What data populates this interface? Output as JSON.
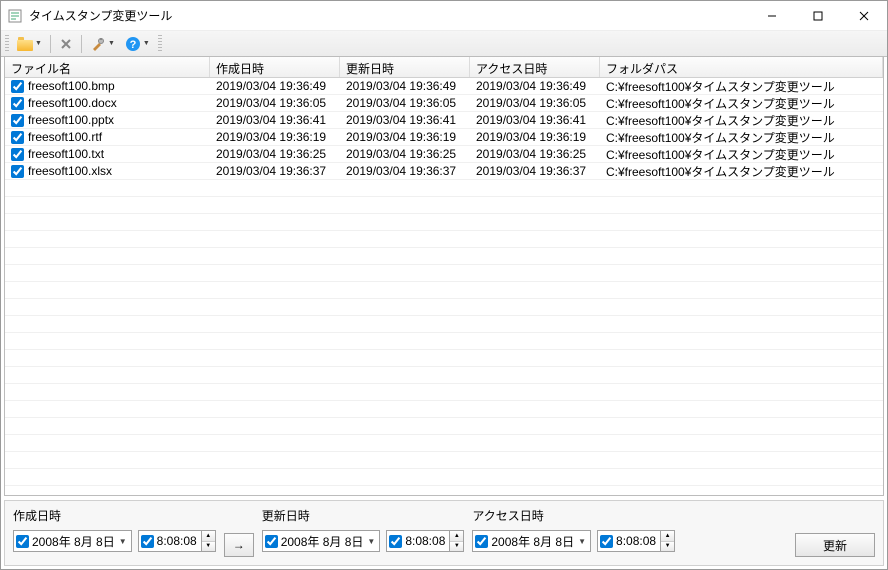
{
  "window": {
    "title": "タイムスタンプ変更ツール"
  },
  "toolbar": {
    "open_icon": "folder-open",
    "delete_icon": "x-delete",
    "settings_icon": "tools",
    "help_icon": "help"
  },
  "columns": {
    "name": "ファイル名",
    "created": "作成日時",
    "modified": "更新日時",
    "accessed": "アクセス日時",
    "path": "フォルダパス"
  },
  "files": [
    {
      "checked": true,
      "name": "freesoft100.bmp",
      "created": "2019/03/04 19:36:49",
      "modified": "2019/03/04 19:36:49",
      "accessed": "2019/03/04 19:36:49",
      "path": "C:¥freesoft100¥タイムスタンプ変更ツール"
    },
    {
      "checked": true,
      "name": "freesoft100.docx",
      "created": "2019/03/04 19:36:05",
      "modified": "2019/03/04 19:36:05",
      "accessed": "2019/03/04 19:36:05",
      "path": "C:¥freesoft100¥タイムスタンプ変更ツール"
    },
    {
      "checked": true,
      "name": "freesoft100.pptx",
      "created": "2019/03/04 19:36:41",
      "modified": "2019/03/04 19:36:41",
      "accessed": "2019/03/04 19:36:41",
      "path": "C:¥freesoft100¥タイムスタンプ変更ツール"
    },
    {
      "checked": true,
      "name": "freesoft100.rtf",
      "created": "2019/03/04 19:36:19",
      "modified": "2019/03/04 19:36:19",
      "accessed": "2019/03/04 19:36:19",
      "path": "C:¥freesoft100¥タイムスタンプ変更ツール"
    },
    {
      "checked": true,
      "name": "freesoft100.txt",
      "created": "2019/03/04 19:36:25",
      "modified": "2019/03/04 19:36:25",
      "accessed": "2019/03/04 19:36:25",
      "path": "C:¥freesoft100¥タイムスタンプ変更ツール"
    },
    {
      "checked": true,
      "name": "freesoft100.xlsx",
      "created": "2019/03/04 19:36:37",
      "modified": "2019/03/04 19:36:37",
      "accessed": "2019/03/04 19:36:37",
      "path": "C:¥freesoft100¥タイムスタンプ変更ツール"
    }
  ],
  "bottom": {
    "created_label": "作成日時",
    "modified_label": "更新日時",
    "accessed_label": "アクセス日時",
    "date_value": "2008年 8月 8日",
    "time_value": "8:08:08",
    "arrow": "→",
    "update_button": "更新"
  }
}
